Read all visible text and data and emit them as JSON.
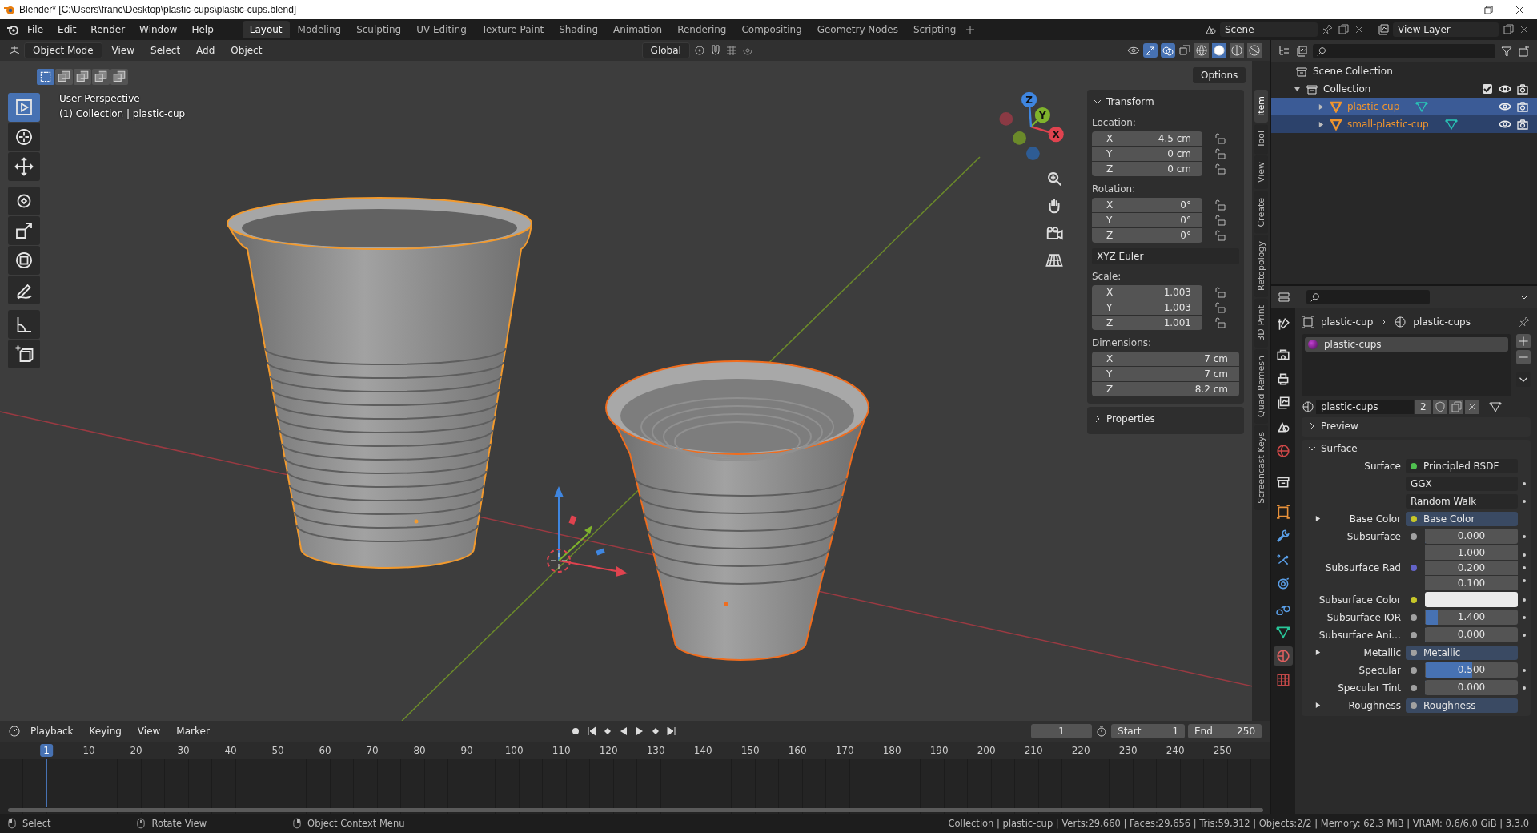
{
  "title_bar": {
    "title": "Blender* [C:\\Users\\franc\\Desktop\\plastic-cups\\plastic-cups.blend]"
  },
  "top_bar": {
    "menus": [
      "File",
      "Edit",
      "Render",
      "Window",
      "Help"
    ],
    "workspaces": [
      {
        "label": "Layout",
        "selected": true
      },
      {
        "label": "Modeling",
        "selected": false
      },
      {
        "label": "Sculpting",
        "selected": false
      },
      {
        "label": "UV Editing",
        "selected": false
      },
      {
        "label": "Texture Paint",
        "selected": false
      },
      {
        "label": "Shading",
        "selected": false
      },
      {
        "label": "Animation",
        "selected": false
      },
      {
        "label": "Rendering",
        "selected": false
      },
      {
        "label": "Compositing",
        "selected": false
      },
      {
        "label": "Geometry Nodes",
        "selected": false
      },
      {
        "label": "Scripting",
        "selected": false
      }
    ],
    "scene": "Scene",
    "view_layer": "View Layer"
  },
  "viewport": {
    "header": {
      "mode": "Object Mode",
      "menus": [
        "View",
        "Select",
        "Add",
        "Object"
      ],
      "orientation": "Global",
      "shading_modes": [
        {
          "kind": "wireframe",
          "selected": false
        },
        {
          "kind": "solid",
          "selected": true
        },
        {
          "kind": "material",
          "selected": false
        },
        {
          "kind": "rendered",
          "selected": false
        }
      ]
    },
    "select_modes": [
      {
        "selected": true
      },
      {
        "selected": false
      },
      {
        "selected": false
      },
      {
        "selected": false
      },
      {
        "selected": false
      }
    ],
    "options": "Options",
    "view_name": "User Perspective",
    "context": "(1) Collection | plastic-cup",
    "tools": [
      {
        "kind": "select",
        "selected": true
      },
      {
        "kind": "cursor",
        "selected": false
      },
      {
        "kind": "move",
        "selected": false
      },
      {
        "kind": "rotate",
        "selected": false
      },
      {
        "kind": "scale",
        "selected": false
      },
      {
        "kind": "transform",
        "selected": false
      },
      {
        "kind": "annotate",
        "selected": false
      },
      {
        "kind": "measure",
        "selected": false
      },
      {
        "kind": "add_cube",
        "selected": false
      }
    ],
    "nav_axes": [
      {
        "label": "X",
        "color": "#e0434f"
      },
      {
        "label": "Y",
        "color": "#7fb32c"
      },
      {
        "label": "Z",
        "color": "#3f86e0"
      }
    ],
    "sidebar_tabs": [
      {
        "label": "Item",
        "selected": true
      },
      {
        "label": "Tool",
        "selected": false
      },
      {
        "label": "View",
        "selected": false
      },
      {
        "label": "Create",
        "selected": false
      },
      {
        "label": "Retopology",
        "selected": false
      },
      {
        "label": "3D-Print",
        "selected": false
      },
      {
        "label": "Quad Remesh",
        "selected": false
      },
      {
        "label": "Screencast Keys",
        "selected": false
      }
    ],
    "transform": {
      "title": "Transform",
      "expanded": true,
      "groups": [
        {
          "kind": "vector",
          "label": "Location:",
          "lockable": true,
          "rows": [
            {
              "axis": "X",
              "value": "-4.5 cm"
            },
            {
              "axis": "Y",
              "value": "0 cm"
            },
            {
              "axis": "Z",
              "value": "0 cm"
            }
          ]
        },
        {
          "kind": "vector",
          "label": "Rotation:",
          "lockable": true,
          "rows": [
            {
              "axis": "X",
              "value": "0°"
            },
            {
              "axis": "Y",
              "value": "0°"
            },
            {
              "axis": "Z",
              "value": "0°"
            }
          ]
        },
        {
          "kind": "dropdown",
          "value": "XYZ Euler"
        },
        {
          "kind": "vector",
          "label": "Scale:",
          "lockable": true,
          "rows": [
            {
              "axis": "X",
              "value": "1.003"
            },
            {
              "axis": "Y",
              "value": "1.003"
            },
            {
              "axis": "Z",
              "value": "1.001"
            }
          ]
        },
        {
          "kind": "vector",
          "label": "Dimensions:",
          "lockable": false,
          "rows": [
            {
              "axis": "X",
              "value": "7 cm"
            },
            {
              "axis": "Y",
              "value": "7 cm"
            },
            {
              "axis": "Z",
              "value": "8.2 cm"
            }
          ]
        }
      ]
    },
    "properties_panel": {
      "title": "Properties",
      "expanded": false
    }
  },
  "outliner": {
    "root": {
      "label": "Scene Collection",
      "children": [
        {
          "label": "Collection",
          "expanded": true,
          "checked": true,
          "children": [
            {
              "label": "plastic-cup",
              "selected": true,
              "active": true,
              "expanded": false
            },
            {
              "label": "small-plastic-cup",
              "selected": true,
              "active": false,
              "expanded": false
            }
          ]
        }
      ]
    }
  },
  "properties": {
    "tabs": [
      {
        "kind": "tool",
        "selected": false
      },
      {
        "kind": "render",
        "selected": false
      },
      {
        "kind": "output",
        "selected": false
      },
      {
        "kind": "view_layer",
        "selected": false
      },
      {
        "kind": "scene",
        "selected": false
      },
      {
        "kind": "world",
        "selected": false
      },
      {
        "kind": "collection",
        "selected": false
      },
      {
        "kind": "object",
        "selected": false
      },
      {
        "kind": "modifiers",
        "selected": false
      },
      {
        "kind": "particles",
        "selected": false
      },
      {
        "kind": "physics",
        "selected": false
      },
      {
        "kind": "constraints",
        "selected": false
      },
      {
        "kind": "data",
        "selected": false
      },
      {
        "kind": "material",
        "selected": true
      },
      {
        "kind": "texture",
        "selected": false
      }
    ],
    "breadcrumb": [
      "plastic-cup",
      "plastic-cups"
    ],
    "slots": [
      {
        "label": "plastic-cups",
        "selected": true
      }
    ],
    "material": {
      "name": "plastic-cups",
      "users": "2"
    },
    "panels": [
      {
        "title": "Preview",
        "expanded": false
      },
      {
        "title": "Surface",
        "expanded": true,
        "rows": [
          {
            "kind": "node",
            "label": "Surface",
            "value": "Principled BSDF",
            "color": "#4fbf4f"
          },
          {
            "kind": "dropdown",
            "value": "GGX"
          },
          {
            "kind": "dropdown",
            "value": "Random Walk"
          },
          {
            "kind": "link",
            "label": "Base Color",
            "value": "Base Color",
            "color": "#c7c729",
            "expandable": true
          },
          {
            "kind": "value",
            "label": "Subsurface",
            "value": "0.000",
            "color": "#a1a1a1",
            "level": 0
          },
          {
            "kind": "vector",
            "label": "Subsurface Rad",
            "values": [
              "1.000",
              "0.200",
              "0.100"
            ],
            "color": "#6363c7"
          },
          {
            "kind": "color",
            "label": "Subsurface Color",
            "color": "#c7c729"
          },
          {
            "kind": "value",
            "label": "Subsurface IOR",
            "value": "1.400",
            "color": "#a1a1a1",
            "level": 0.13
          },
          {
            "kind": "value",
            "label": "Subsurface Ani…",
            "value": "0.000",
            "color": "#a1a1a1",
            "level": 0
          },
          {
            "kind": "link",
            "label": "Metallic",
            "value": "Metallic",
            "color": "#a1a1a1",
            "expandable": true
          },
          {
            "kind": "value",
            "label": "Specular",
            "value": "0.500",
            "color": "#a1a1a1",
            "level": 0.5
          },
          {
            "kind": "value",
            "label": "Specular Tint",
            "value": "0.000",
            "color": "#a1a1a1",
            "level": 0
          },
          {
            "kind": "link",
            "label": "Roughness",
            "value": "Roughness",
            "color": "#a1a1a1",
            "expandable": true
          }
        ]
      }
    ]
  },
  "timeline": {
    "menus": [
      "Playback",
      "Keying",
      "View",
      "Marker"
    ],
    "current": "1",
    "start_label": "Start",
    "start": "1",
    "end_label": "End",
    "end": "250",
    "ruler": [
      {
        "label": "1",
        "selected": true
      },
      {
        "label": "10",
        "selected": false
      },
      {
        "label": "20",
        "selected": false
      },
      {
        "label": "30",
        "selected": false
      },
      {
        "label": "40",
        "selected": false
      },
      {
        "label": "50",
        "selected": false
      },
      {
        "label": "60",
        "selected": false
      },
      {
        "label": "70",
        "selected": false
      },
      {
        "label": "80",
        "selected": false
      },
      {
        "label": "90",
        "selected": false
      },
      {
        "label": "100",
        "selected": false
      },
      {
        "label": "110",
        "selected": false
      },
      {
        "label": "120",
        "selected": false
      },
      {
        "label": "130",
        "selected": false
      },
      {
        "label": "140",
        "selected": false
      },
      {
        "label": "150",
        "selected": false
      },
      {
        "label": "160",
        "selected": false
      },
      {
        "label": "170",
        "selected": false
      },
      {
        "label": "180",
        "selected": false
      },
      {
        "label": "190",
        "selected": false
      },
      {
        "label": "200",
        "selected": false
      },
      {
        "label": "210",
        "selected": false
      },
      {
        "label": "220",
        "selected": false
      },
      {
        "label": "230",
        "selected": false
      },
      {
        "label": "240",
        "selected": false
      },
      {
        "label": "250",
        "selected": false
      }
    ]
  },
  "status_bar": {
    "hints": [
      "Select",
      "Rotate View",
      "Object Context Menu"
    ],
    "stats": "Collection | plastic-cup | Verts:29,660 | Faces:29,656 | Tris:59,312 | Objects:2/2 | Memory: 62.3 MiB | VRAM: 0.6/6.0 GiB | 3.3.0"
  }
}
